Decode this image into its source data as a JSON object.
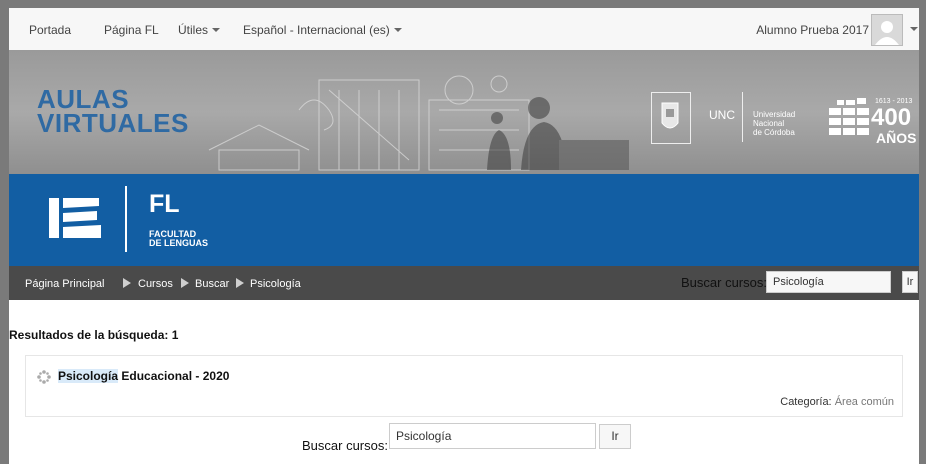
{
  "navbar": {
    "items": [
      {
        "label": "Portada",
        "dropdown": false
      },
      {
        "label": "Página FL",
        "dropdown": false
      },
      {
        "label": "Útiles",
        "dropdown": true
      },
      {
        "label": "Español - Internacional (es)",
        "dropdown": true
      }
    ],
    "user_name": "Alumno Prueba 2017"
  },
  "banner": {
    "title_line1": "AULAS",
    "title_line2": "VIRTUALES",
    "unc_abbr": "UNC",
    "unc_line1": "Universidad",
    "unc_line2": "Nacional",
    "unc_line3": "de Córdoba",
    "years_range": "1613 - 2013",
    "years_num": "400",
    "years_word": "AÑOS"
  },
  "faculty": {
    "abbr": "FL",
    "name_line1": "FACULTAD",
    "name_line2": "DE LENGUAS"
  },
  "breadcrumb": {
    "items": [
      "Página Principal",
      "Cursos",
      "Buscar",
      "Psicología"
    ],
    "search_label": "Buscar cursos:",
    "search_value": "Psicología",
    "go_label": "Ir"
  },
  "results": {
    "heading": "Resultados de la búsqueda: 1",
    "course": {
      "title_highlight": "Psicología",
      "title_rest": " Educacional - 2020",
      "category_label": "Categoría:",
      "category_value": "Área común"
    }
  },
  "bottom_search": {
    "label": "Buscar cursos:",
    "value": "Psicología",
    "go_label": "Ir"
  },
  "colors": {
    "brand_blue": "#125ea3",
    "breadcrumb_bg": "#4a4a4a",
    "title_blue": "#2f6aa3"
  }
}
